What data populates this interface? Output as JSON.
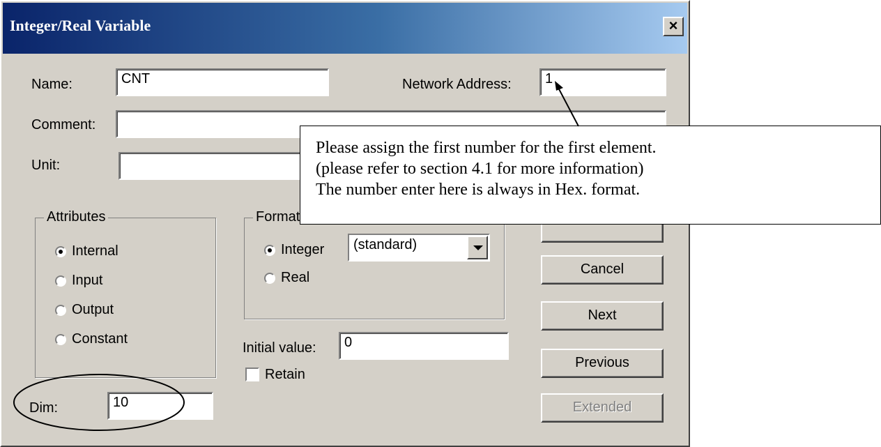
{
  "dialog": {
    "title": "Integer/Real Variable",
    "close_label": "×"
  },
  "fields": {
    "name_label": "Name:",
    "name_value": "CNT",
    "network_address_label": "Network Address:",
    "network_address_value": "1",
    "comment_label": "Comment:",
    "comment_value": "",
    "unit_label": "Unit:",
    "unit_value": "",
    "initial_value_label": "Initial value:",
    "initial_value": "0",
    "dim_label": "Dim:",
    "dim_value": "10"
  },
  "attributes": {
    "legend": "Attributes",
    "options": [
      {
        "label": "Internal",
        "selected": true
      },
      {
        "label": "Input",
        "selected": false
      },
      {
        "label": "Output",
        "selected": false
      },
      {
        "label": "Constant",
        "selected": false
      }
    ]
  },
  "format": {
    "legend": "Format",
    "options": [
      {
        "label": "Integer",
        "selected": true
      },
      {
        "label": "Real",
        "selected": false
      }
    ],
    "dropdown_value": "(standard)"
  },
  "retain": {
    "label": "Retain",
    "checked": false
  },
  "buttons": {
    "ok_partial": "",
    "cancel": "Cancel",
    "next": "Next",
    "previous": "Previous",
    "extended": "Extended"
  },
  "callout": {
    "lines": [
      "Please assign the first number for the first element.",
      "(please refer to section 4.1 for more information)",
      "The number enter here is always in Hex. format."
    ]
  },
  "colors": {
    "dialog_face": "#d4d0c8",
    "title_start": "#0a246a",
    "title_end": "#a6caf0"
  }
}
